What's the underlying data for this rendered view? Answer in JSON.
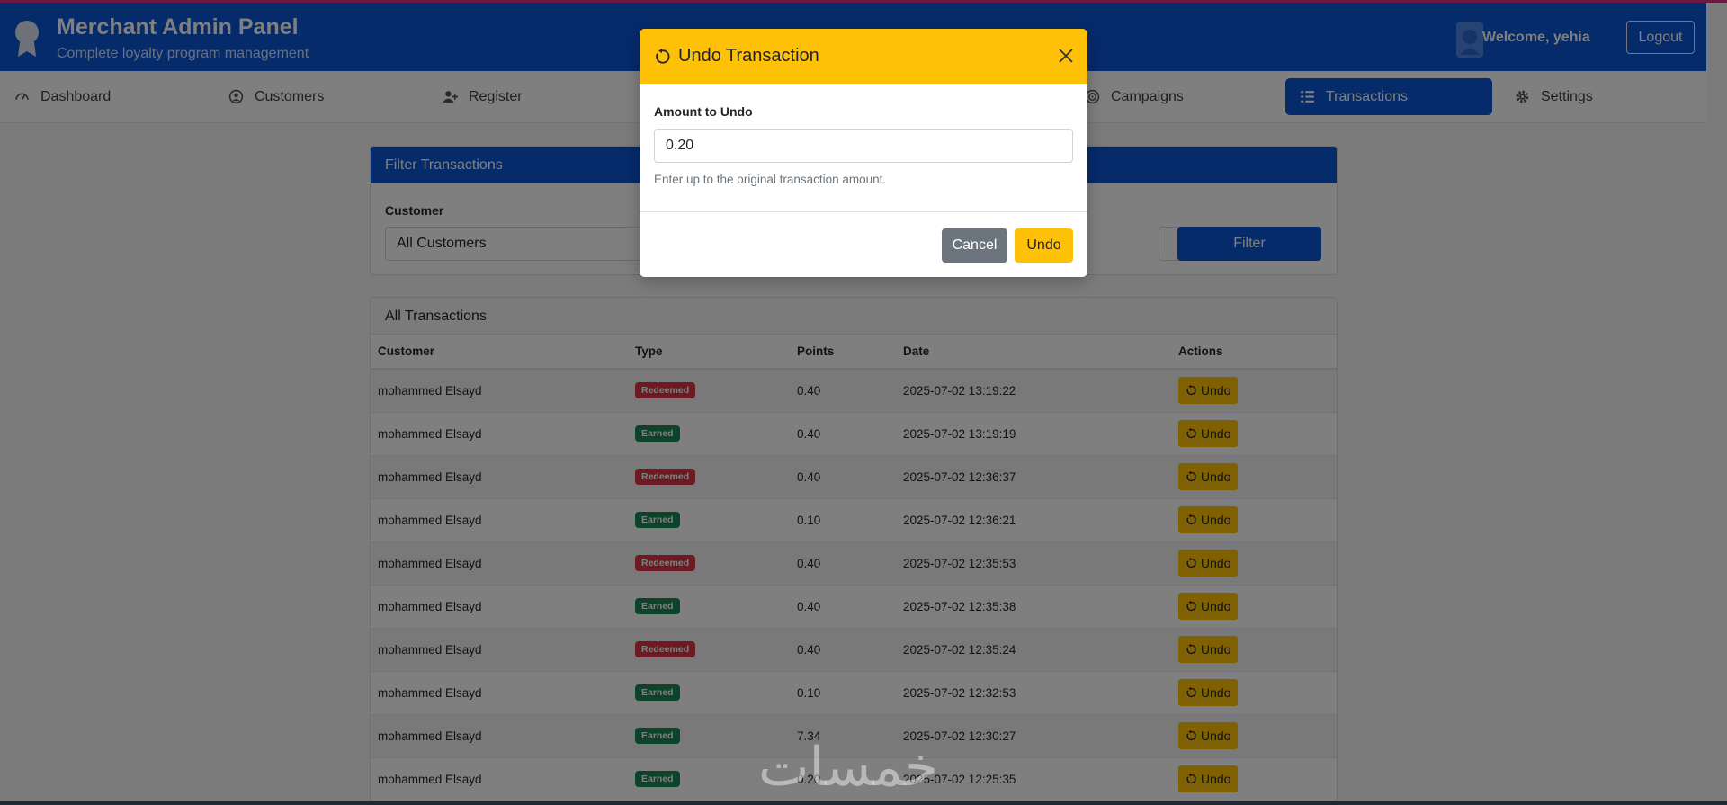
{
  "header": {
    "title": "Merchant Admin Panel",
    "subtitle": "Complete loyalty program management",
    "welcome": "Welcome, yehia",
    "logout": "Logout"
  },
  "nav": {
    "items": [
      {
        "label": "Dashboard",
        "icon": "dashboard-icon"
      },
      {
        "label": "Customers",
        "icon": "user-circle-icon"
      },
      {
        "label": "Register",
        "icon": "user-plus-icon"
      },
      {
        "label": "Campaigns",
        "icon": "bullseye-icon"
      },
      {
        "label": "Transactions",
        "icon": "list-icon",
        "active": true
      },
      {
        "label": "Settings",
        "icon": "gear-icon"
      }
    ]
  },
  "filter": {
    "title": "Filter Transactions",
    "customer_label": "Customer",
    "customer_value": "All Customers",
    "button": "Filter"
  },
  "transactions": {
    "title": "All Transactions",
    "columns": [
      "Customer",
      "Type",
      "Points",
      "Date",
      "Actions"
    ],
    "undo_label": "Undo",
    "rows": [
      {
        "customer": "mohammed Elsayd",
        "type": "Redeemed",
        "points": "0.40",
        "date": "2025-07-02 13:19:22"
      },
      {
        "customer": "mohammed Elsayd",
        "type": "Earned",
        "points": "0.40",
        "date": "2025-07-02 13:19:19"
      },
      {
        "customer": "mohammed Elsayd",
        "type": "Redeemed",
        "points": "0.40",
        "date": "2025-07-02 12:36:37"
      },
      {
        "customer": "mohammed Elsayd",
        "type": "Earned",
        "points": "0.10",
        "date": "2025-07-02 12:36:21"
      },
      {
        "customer": "mohammed Elsayd",
        "type": "Redeemed",
        "points": "0.40",
        "date": "2025-07-02 12:35:53"
      },
      {
        "customer": "mohammed Elsayd",
        "type": "Earned",
        "points": "0.40",
        "date": "2025-07-02 12:35:38"
      },
      {
        "customer": "mohammed Elsayd",
        "type": "Redeemed",
        "points": "0.40",
        "date": "2025-07-02 12:35:24"
      },
      {
        "customer": "mohammed Elsayd",
        "type": "Earned",
        "points": "0.10",
        "date": "2025-07-02 12:32:53"
      },
      {
        "customer": "mohammed Elsayd",
        "type": "Earned",
        "points": "7.34",
        "date": "2025-07-02 12:30:27"
      },
      {
        "customer": "mohammed Elsayd",
        "type": "Earned",
        "points": "0.20",
        "date": "2025-07-02 12:25:35"
      }
    ]
  },
  "modal": {
    "title": "Undo Transaction",
    "amount_label": "Amount to Undo",
    "amount_value": "0.20",
    "help": "Enter up to the original transaction amount.",
    "cancel": "Cancel",
    "confirm": "Undo"
  },
  "watermark": "خمسات",
  "colors": {
    "primary": "#0d56d6",
    "warning": "#ffc107",
    "danger": "#dc3545",
    "success": "#198754",
    "secondary": "#6c757d"
  }
}
